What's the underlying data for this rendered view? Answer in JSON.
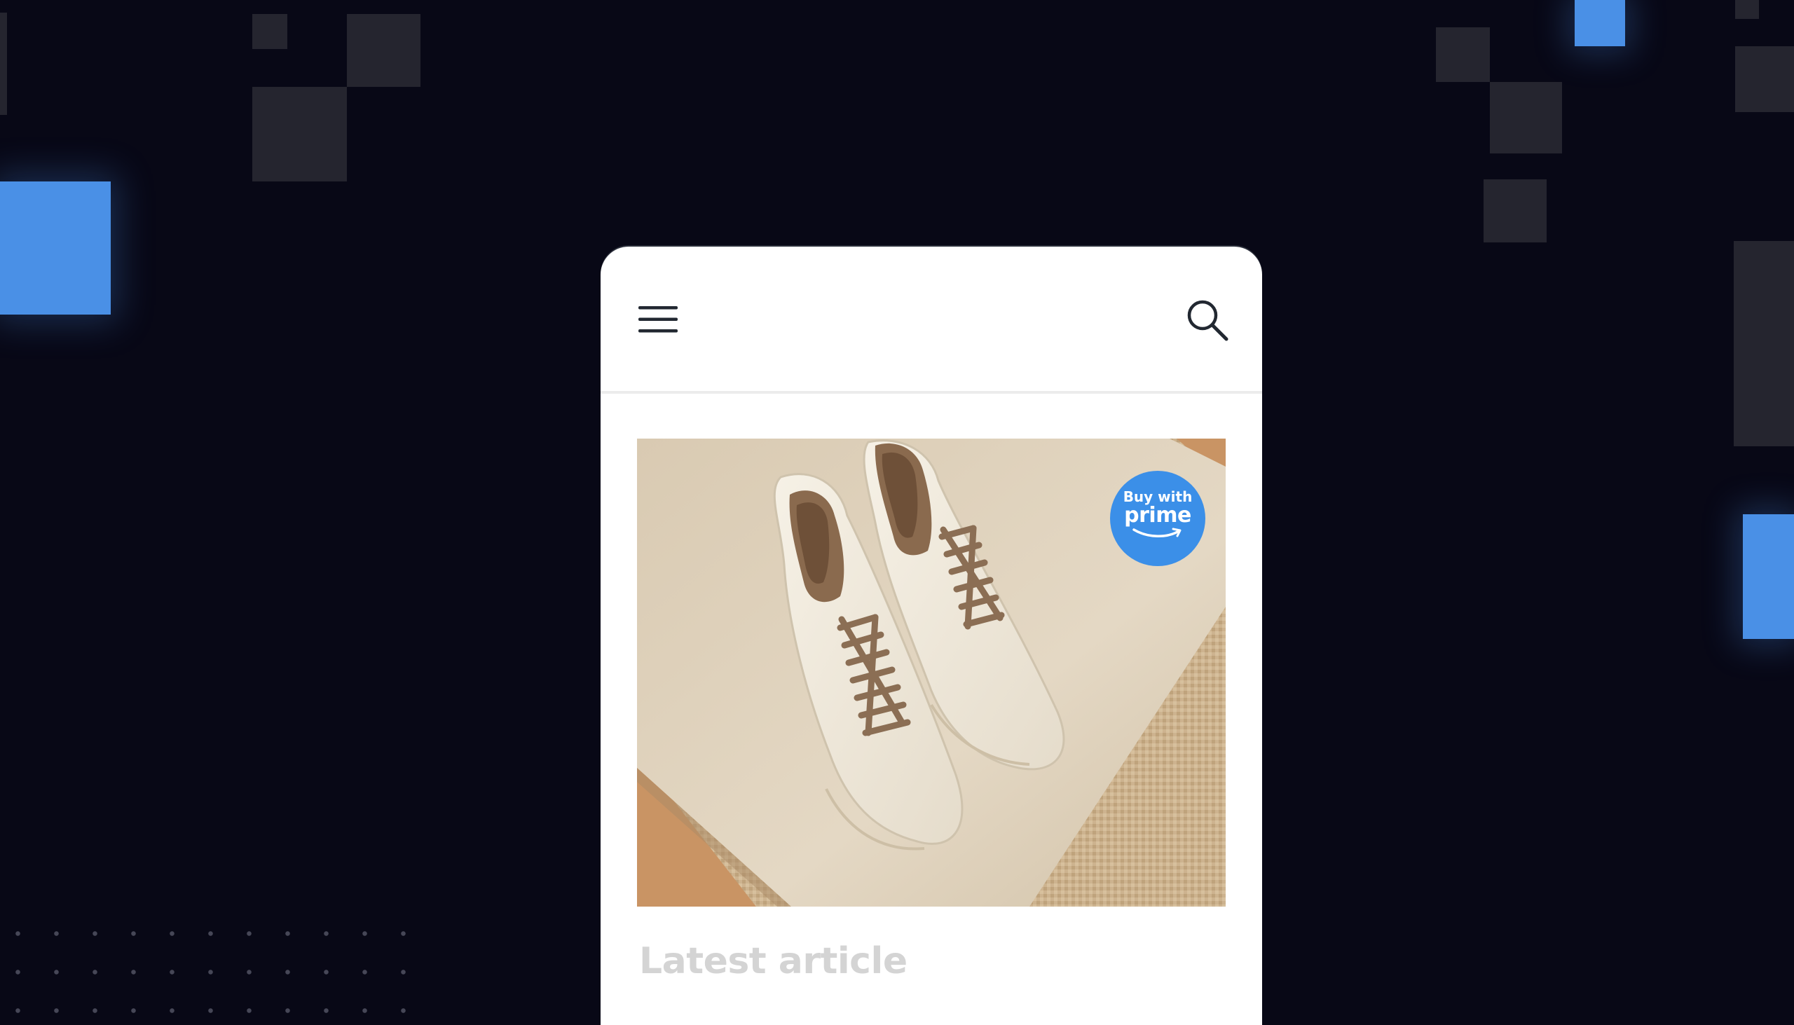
{
  "background": {
    "color": "#080816",
    "tile_color": "#25252f",
    "accent_color": "#4a90e6"
  },
  "header": {
    "menu_icon": "hamburger-menu-icon",
    "search_icon": "search-icon"
  },
  "hero": {
    "image": "product-photo-white-leather-sneakers",
    "badge": {
      "line1": "Buy with",
      "line2": "prime",
      "color": "#3b8fe8"
    }
  },
  "article": {
    "title": "Latest article"
  }
}
